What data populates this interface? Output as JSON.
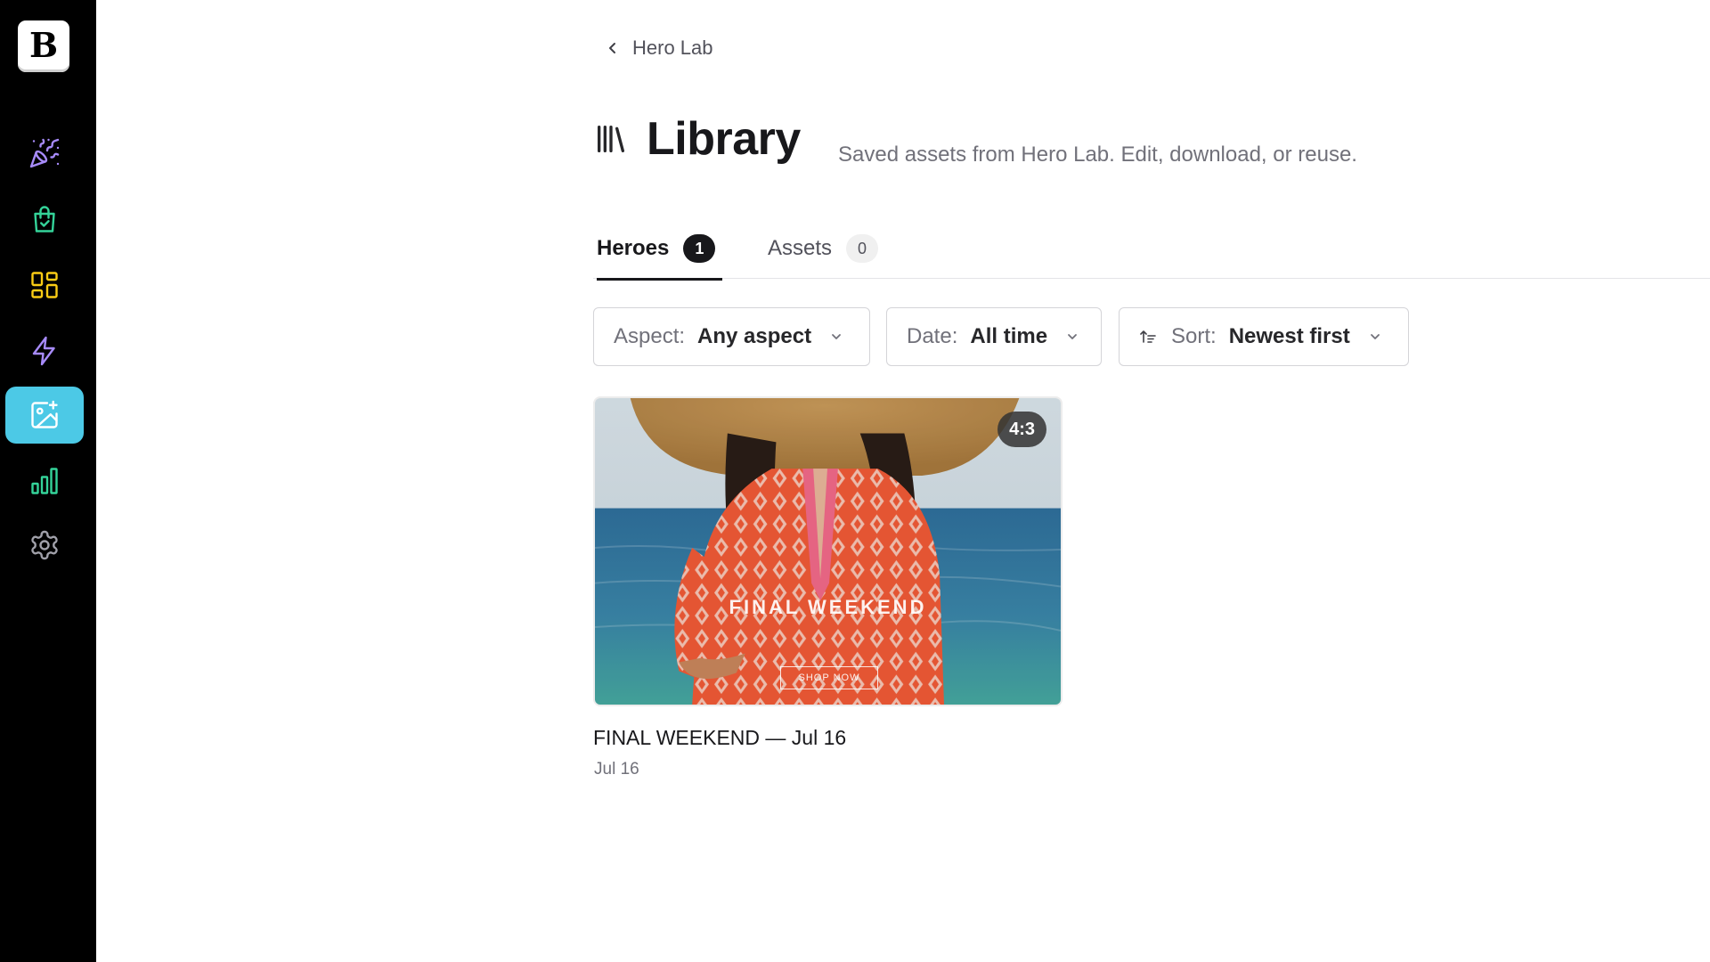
{
  "app": {
    "logo_glyph": "B",
    "brand_color": "#000000",
    "active_color": "#4cc9e6"
  },
  "sidebar": {
    "items": [
      {
        "icon": "party-popper-icon",
        "color": "#a78bfa",
        "active": false
      },
      {
        "icon": "shopping-bag-icon",
        "color": "#34d399",
        "active": false
      },
      {
        "icon": "dashboard-grid-icon",
        "color": "#facc15",
        "active": false
      },
      {
        "icon": "lightning-icon",
        "color": "#a78bfa",
        "active": false
      },
      {
        "icon": "image-sparkle-icon",
        "color": "#ffffff",
        "active": true
      },
      {
        "icon": "bar-chart-icon",
        "color": "#34d399",
        "active": false
      },
      {
        "icon": "gear-icon",
        "color": "#a1a1aa",
        "active": false
      }
    ]
  },
  "header": {
    "back_label": "Hero Lab",
    "title": "Library",
    "subtitle": "Saved assets from Hero Lab. Edit, download, or reuse."
  },
  "tabs": [
    {
      "label": "Heroes",
      "count": "1",
      "active": true
    },
    {
      "label": "Assets",
      "count": "0",
      "active": false
    }
  ],
  "filters": {
    "aspect": {
      "label": "Aspect:",
      "value": "Any aspect"
    },
    "date": {
      "label": "Date:",
      "value": "All time"
    },
    "sort": {
      "label": "Sort:",
      "value": "Newest first"
    }
  },
  "cards": [
    {
      "title": "FINAL WEEKEND — Jul 16",
      "date": "Jul 16",
      "ratio": "4:3",
      "overlay_title": "FINAL WEEKEND",
      "overlay_button": "SHOP NOW"
    }
  ]
}
